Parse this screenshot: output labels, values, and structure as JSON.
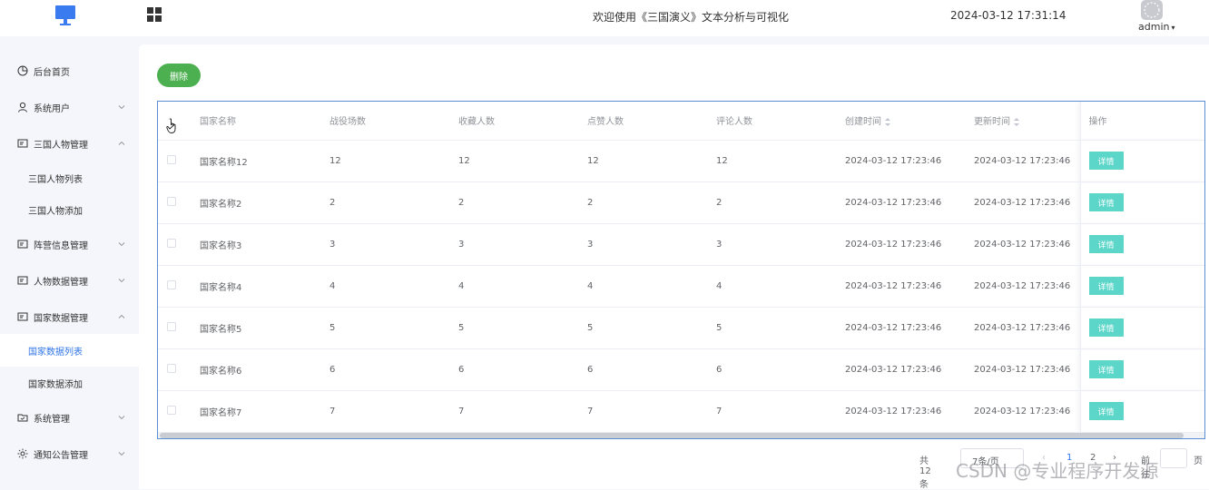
{
  "header": {
    "welcome": "欢迎使用《三国演义》文本分析与可视化",
    "datetime": "2024-03-12 17:31:14",
    "username": "admin",
    "caret": "▾"
  },
  "sidebar": {
    "items": [
      {
        "label": "后台首页",
        "icon": "dashboard-icon"
      },
      {
        "label": "系统用户",
        "icon": "user-icon"
      },
      {
        "label": "三国人物管理",
        "icon": "list-icon"
      },
      {
        "label": "阵营信息管理",
        "icon": "list-icon"
      },
      {
        "label": "人物数据管理",
        "icon": "list-icon"
      },
      {
        "label": "国家数据管理",
        "icon": "list-icon"
      },
      {
        "label": "系统管理",
        "icon": "folder-icon"
      },
      {
        "label": "通知公告管理",
        "icon": "sun-icon"
      }
    ],
    "sub_people": [
      "三国人物列表",
      "三国人物添加"
    ],
    "sub_country": [
      "国家数据列表",
      "国家数据添加"
    ]
  },
  "toolbar": {
    "delete_label": "删除"
  },
  "table": {
    "headers": [
      "国家名称",
      "战役场数",
      "收藏人数",
      "点赞人数",
      "评论人数",
      "创建时间",
      "更新时间",
      "操作"
    ],
    "rows": [
      [
        "国家名称12",
        "12",
        "12",
        "12",
        "12",
        "2024-03-12 17:23:46",
        "2024-03-12 17:23:46"
      ],
      [
        "国家名称2",
        "2",
        "2",
        "2",
        "2",
        "2024-03-12 17:23:46",
        "2024-03-12 17:23:46"
      ],
      [
        "国家名称3",
        "3",
        "3",
        "3",
        "3",
        "2024-03-12 17:23:46",
        "2024-03-12 17:23:46"
      ],
      [
        "国家名称4",
        "4",
        "4",
        "4",
        "4",
        "2024-03-12 17:23:46",
        "2024-03-12 17:23:46"
      ],
      [
        "国家名称5",
        "5",
        "5",
        "5",
        "5",
        "2024-03-12 17:23:46",
        "2024-03-12 17:23:46"
      ],
      [
        "国家名称6",
        "6",
        "6",
        "6",
        "6",
        "2024-03-12 17:23:46",
        "2024-03-12 17:23:46"
      ],
      [
        "国家名称7",
        "7",
        "7",
        "7",
        "7",
        "2024-03-12 17:23:46",
        "2024-03-12 17:23:46"
      ]
    ],
    "detail_label": "详情"
  },
  "pagination": {
    "total": "共 12 条",
    "page_size": "7条/页",
    "pages": [
      "1",
      "2"
    ],
    "current": "1",
    "goto_prefix": "前往",
    "goto_suffix": "页"
  },
  "watermark": "CSDN @专业程序开发源",
  "colors": {
    "accent": "#2f74e6",
    "delete_button": "#4caf50",
    "detail_button": "#5bd6c8",
    "table_border": "#5b8fd4"
  }
}
